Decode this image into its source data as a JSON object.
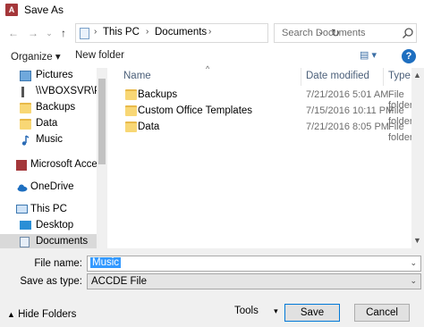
{
  "window": {
    "title": "Save As",
    "app_icon_text": "A"
  },
  "nav": {
    "back": "←",
    "forward": "→",
    "dropdown": "⌄",
    "up": "↑",
    "address": [
      "This PC",
      "Documents"
    ],
    "sep": "›",
    "address_dropdown": "⌄",
    "refresh": "↻",
    "search_placeholder": "Search Documents"
  },
  "commands": {
    "organize": "Organize ▾",
    "new_folder": "New folder",
    "view": "▤ ▾",
    "help": "?"
  },
  "sidebar": [
    {
      "label": "Pictures",
      "icon": "pictures-icon"
    },
    {
      "label": "\\\\VBOXSVR\\Pub",
      "icon": "network-drive-icon"
    },
    {
      "label": "Backups",
      "icon": "folder-icon"
    },
    {
      "label": "Data",
      "icon": "folder-icon"
    },
    {
      "label": "Music",
      "icon": "music-icon"
    },
    {
      "label": "Microsoft Access",
      "icon": "access-icon"
    },
    {
      "label": "OneDrive",
      "icon": "onedrive-icon"
    },
    {
      "label": "This PC",
      "icon": "pc-icon"
    },
    {
      "label": "Desktop",
      "icon": "desktop-icon"
    },
    {
      "label": "Documents",
      "icon": "documents-icon",
      "selected": true
    }
  ],
  "columns": {
    "name": "Name",
    "date": "Date modified",
    "type": "Type"
  },
  "files": [
    {
      "name": "Backups",
      "date": "7/21/2016 5:01 AM",
      "type": "File folder"
    },
    {
      "name": "Custom Office Templates",
      "date": "7/15/2016 10:11 PM",
      "type": "File folder"
    },
    {
      "name": "Data",
      "date": "7/21/2016 8:05 PM",
      "type": "File folder"
    }
  ],
  "form": {
    "file_name_label": "File name:",
    "file_name_value": "Music",
    "save_type_label": "Save as type:",
    "save_type_value": "ACCDE File",
    "dropdown": "⌄"
  },
  "footer": {
    "hide_folders": "Hide Folders",
    "tools": "Tools",
    "tools_arrow": "▾",
    "save": "Save",
    "cancel": "Cancel"
  }
}
